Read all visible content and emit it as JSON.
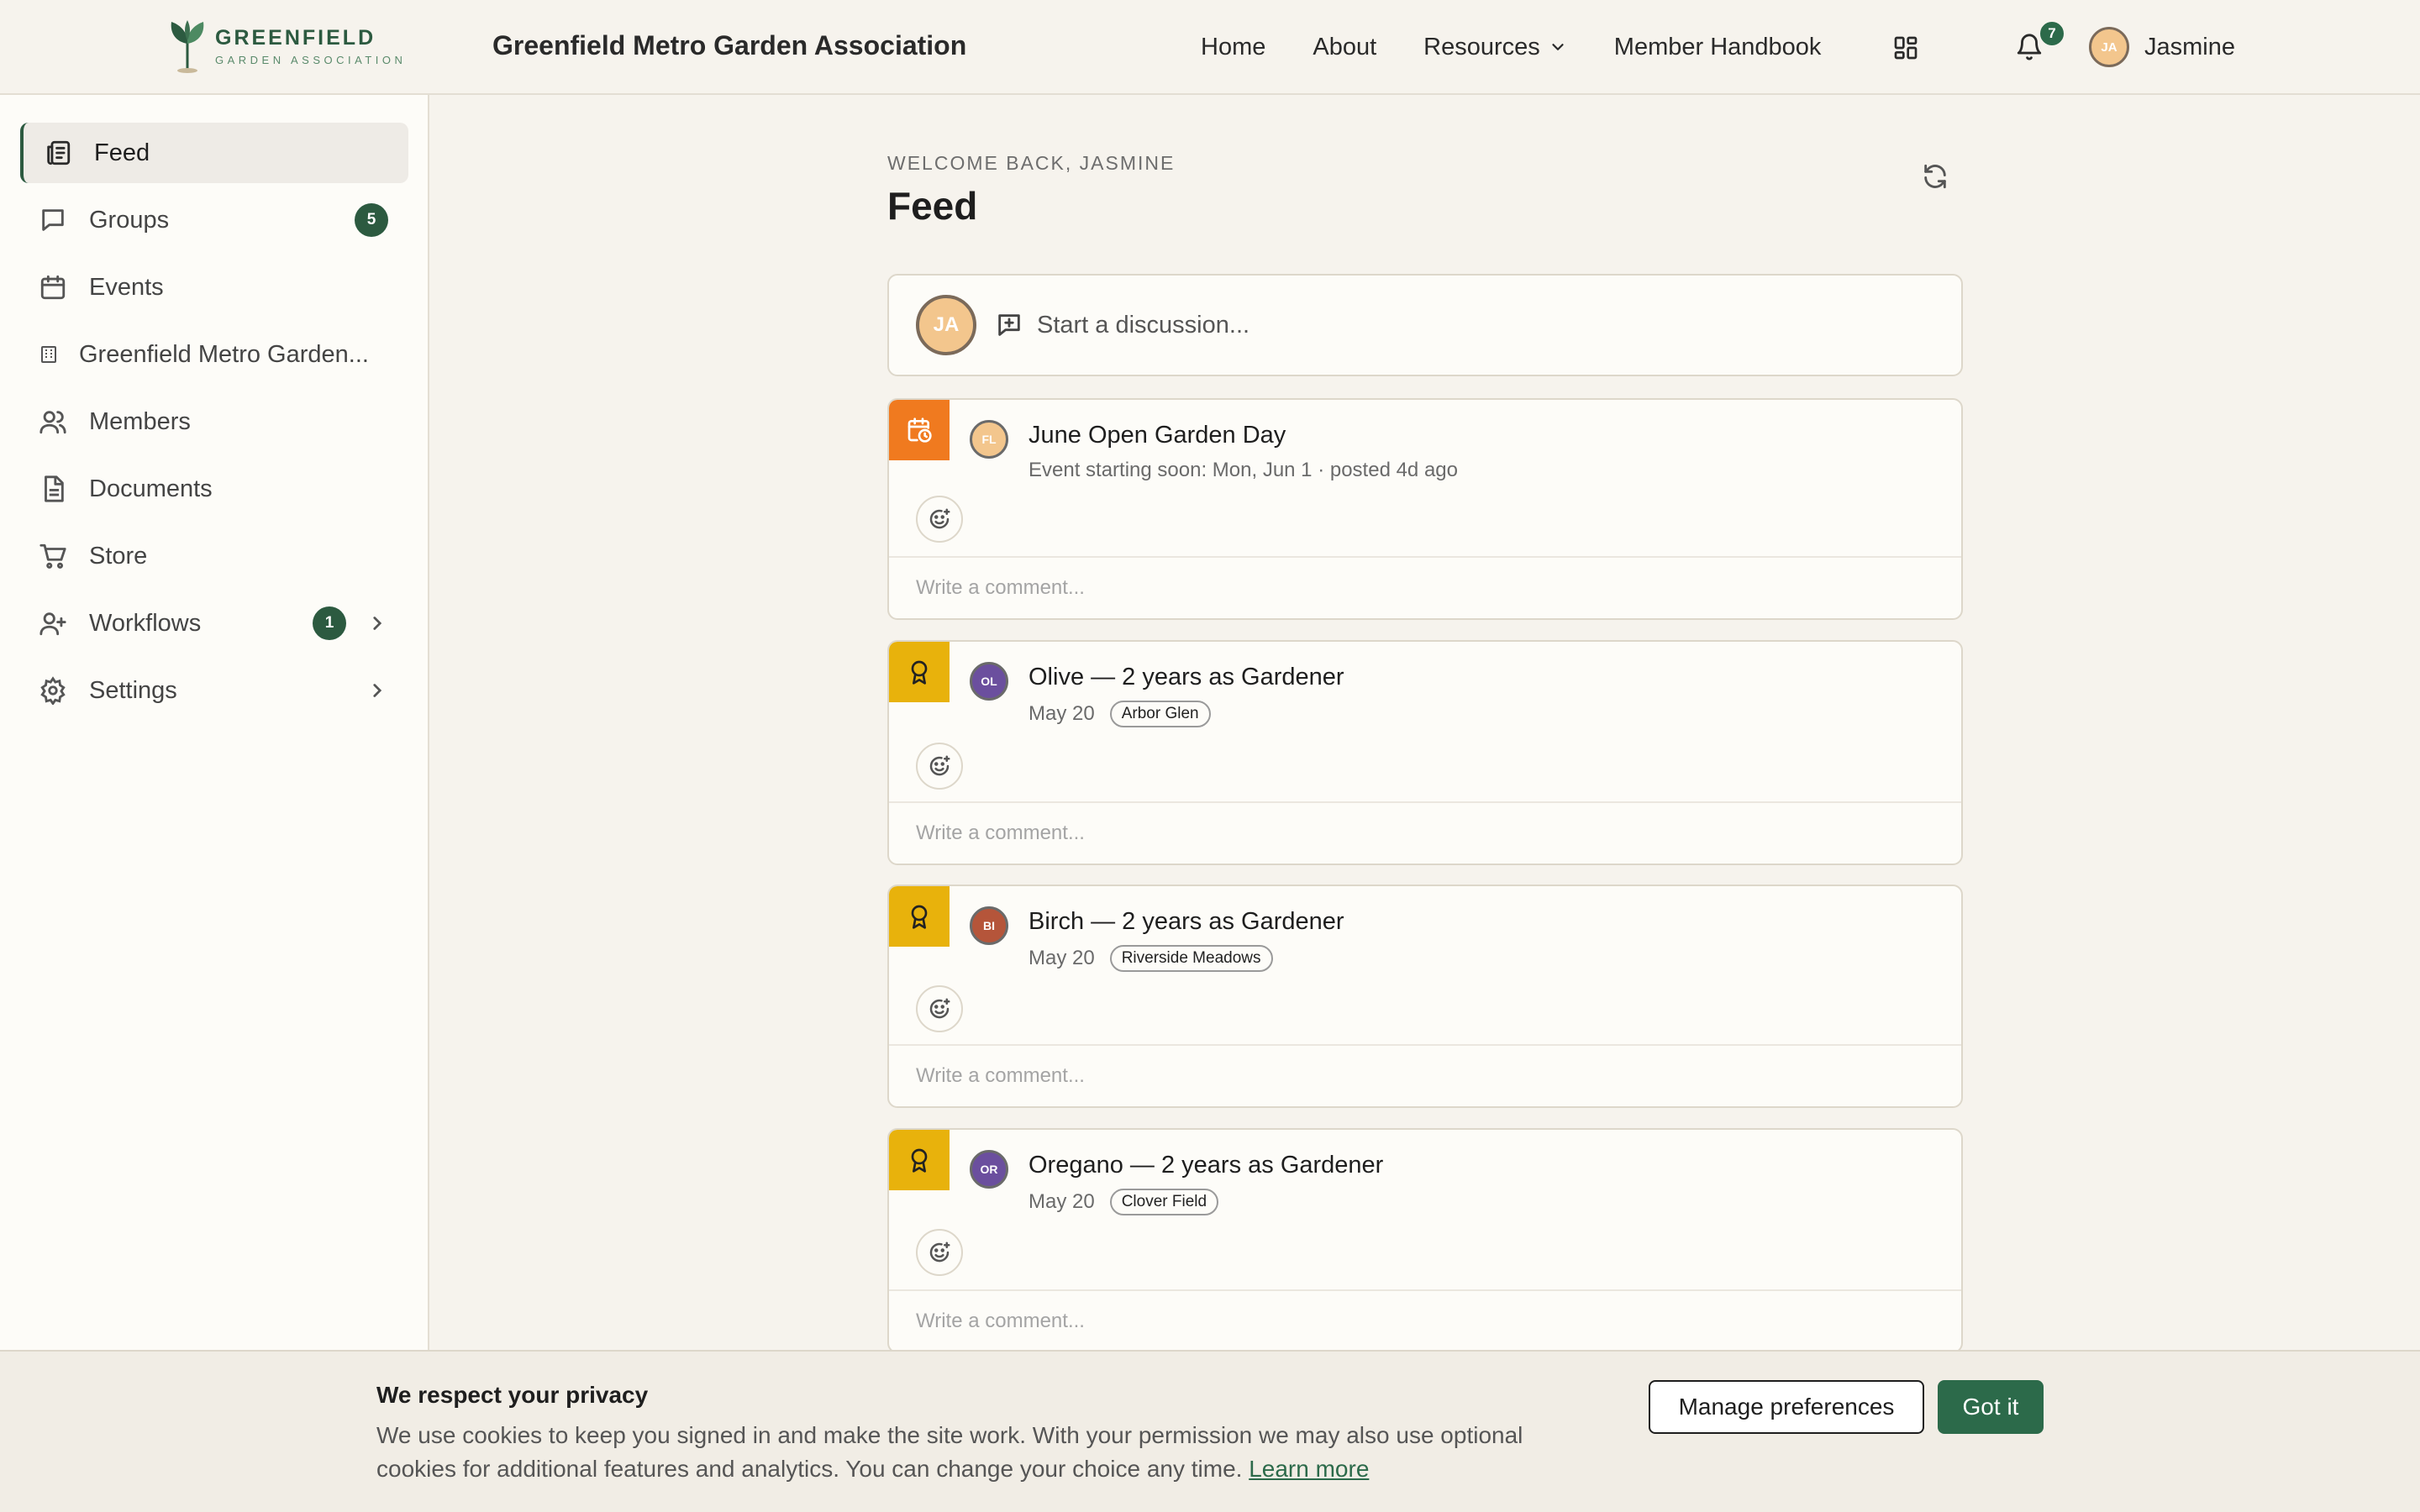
{
  "brand": {
    "name": "GREENFIELD",
    "subtitle": "GARDEN ASSOCIATION"
  },
  "header": {
    "org_title": "Greenfield Metro Garden Association",
    "nav": [
      "Home",
      "About",
      "Resources",
      "Member Handbook"
    ],
    "notifications_count": "7",
    "user_initials": "JA",
    "user_name": "Jasmine"
  },
  "sidebar": {
    "items": [
      {
        "label": "Feed",
        "icon": "feed-icon"
      },
      {
        "label": "Groups",
        "icon": "chat-bubble-icon",
        "badge": "5"
      },
      {
        "label": "Events",
        "icon": "calendar-icon"
      },
      {
        "label": "Greenfield Metro Garden...",
        "icon": "building-icon"
      },
      {
        "label": "Members",
        "icon": "members-icon"
      },
      {
        "label": "Documents",
        "icon": "document-icon"
      },
      {
        "label": "Store",
        "icon": "cart-icon"
      },
      {
        "label": "Workflows",
        "icon": "user-plus-icon",
        "badge": "1"
      },
      {
        "label": "Settings",
        "icon": "gear-icon"
      }
    ]
  },
  "main": {
    "welcome": "WELCOME BACK, JASMINE",
    "title": "Feed",
    "composer": {
      "avatar": "JA",
      "placeholder": "Start a discussion..."
    },
    "comment_placeholder": "Write a comment...",
    "posts": [
      {
        "type": "event",
        "flag_color": "#f07a1f",
        "avatar": "FL",
        "avatar_color": "#f3c68d",
        "title": "June Open Garden Day",
        "meta": "Event starting soon: Mon, Jun 1 · posted 4d ago",
        "tag": ""
      },
      {
        "type": "anniversary",
        "flag_color": "#e8b20c",
        "avatar": "OL",
        "avatar_color": "#6b4f9e",
        "title": "Olive — 2 years as Gardener",
        "meta": "May 20",
        "tag": "Arbor Glen"
      },
      {
        "type": "anniversary",
        "flag_color": "#e8b20c",
        "avatar": "BI",
        "avatar_color": "#b5553a",
        "title": "Birch — 2 years as Gardener",
        "meta": "May 20",
        "tag": "Riverside Meadows"
      },
      {
        "type": "anniversary",
        "flag_color": "#e8b20c",
        "avatar": "OR",
        "avatar_color": "#6b4f9e",
        "title": "Oregano — 2 years as Gardener",
        "meta": "May 20",
        "tag": "Clover Field"
      }
    ]
  },
  "cookie": {
    "title": "We respect your privacy",
    "body": "We use cookies to keep you signed in and make the site work. With your permission we may also use optional cookies for additional features and analytics. You can change your choice any time.",
    "link": "Learn more",
    "manage_label": "Manage preferences",
    "accept_label": "Got it"
  },
  "colors": {
    "brand_green": "#2c5a40",
    "accent_green": "#2c6a4a",
    "background": "#f6f3ed"
  }
}
